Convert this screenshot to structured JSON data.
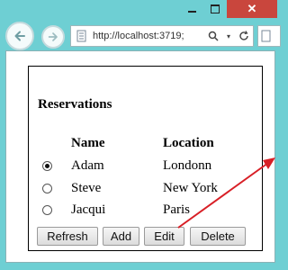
{
  "browser": {
    "url": "http://localhost:3719;",
    "icons": {
      "back": "back-arrow-icon",
      "forward": "forward-arrow-icon",
      "search": "search-icon",
      "refresh": "refresh-icon",
      "close": "close-icon"
    }
  },
  "page": {
    "title": "Reservations",
    "columns": {
      "name": "Name",
      "location": "Location"
    },
    "rows": [
      {
        "name": "Adam",
        "location": "Londonn",
        "selected": true
      },
      {
        "name": "Steve",
        "location": "New York",
        "selected": false
      },
      {
        "name": "Jacqui",
        "location": "Paris",
        "selected": false
      }
    ],
    "buttons": {
      "refresh": "Refresh",
      "add": "Add",
      "edit": "Edit",
      "delete": "Delete"
    }
  },
  "colors": {
    "chrome": "#6ecfd3",
    "close_button": "#c9463d",
    "annotation_arrow": "#d81f26"
  }
}
